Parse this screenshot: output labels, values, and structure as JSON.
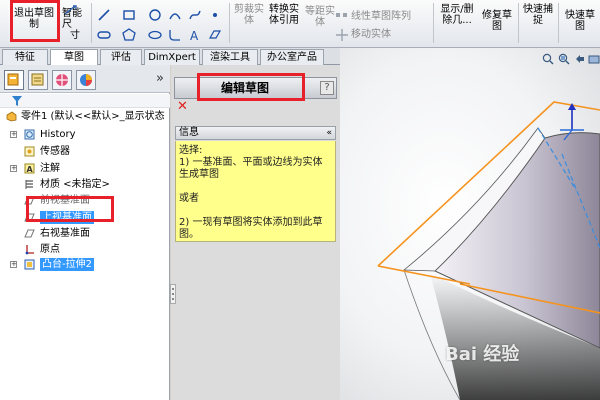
{
  "ribbon": {
    "exit_sketch_label_line1": "退出草图",
    "exit_sketch_label_line2": "制",
    "smart_dim_line1": "智能尺",
    "smart_dim_line2": "寸",
    "trim_label_line1": "剪裁实",
    "trim_label_line2": "体",
    "convert_label_line1": "转换实",
    "convert_label_line2": "体引用",
    "offset_label_line1": "等距实",
    "offset_label_line2": "体",
    "linear_pattern_label": "线性草图阵列",
    "move_entities_label": "移动实体",
    "display_delete_line1": "显示/删",
    "display_delete_line2": "除几...",
    "repair_sketch_line1": "修复草",
    "repair_sketch_line2": "图",
    "quick_snaps_line1": "快速捕",
    "quick_snaps_line2": "捉",
    "rapid_sketch_line1": "快速草",
    "rapid_sketch_line2": "图"
  },
  "command_tabs": [
    "特征",
    "草图",
    "评估",
    "DimXpert",
    "渲染工具",
    "办公室产品"
  ],
  "active_command_tab": "草图",
  "pane": {
    "expand_label": "»",
    "tree": [
      {
        "label": "零件1 (默认<<默认>_显示状态",
        "icon": "part-icon"
      },
      {
        "label": "History",
        "icon": "history-icon"
      },
      {
        "label": "传感器",
        "icon": "sensor-icon"
      },
      {
        "label": "注解",
        "icon": "annotation-icon"
      },
      {
        "label": "材质 <未指定>",
        "icon": "material-icon"
      },
      {
        "label": "前视基准面",
        "icon": "plane-icon"
      },
      {
        "label": "上视基准面",
        "icon": "plane-icon"
      },
      {
        "label": "右视基准面",
        "icon": "plane-icon"
      },
      {
        "label": "原点",
        "icon": "origin-icon"
      },
      {
        "label": "凸台-拉伸2",
        "icon": "extrude-icon"
      }
    ]
  },
  "property_manager": {
    "title": "编辑草图",
    "help": "?",
    "info_header": "信息",
    "info_caret": "«",
    "info_lines": [
      "选择:",
      "1) 一基准面、平面或边线为实体生成草图",
      "或者",
      "2) 一现有草图将实体添加到此草图。"
    ]
  },
  "watermark": "Bai 经验",
  "colors": {
    "highlight_red": "#e8202a",
    "selection_blue": "#3399ff",
    "info_yellow": "#ffff8c",
    "plane_orange": "#f5931e"
  }
}
